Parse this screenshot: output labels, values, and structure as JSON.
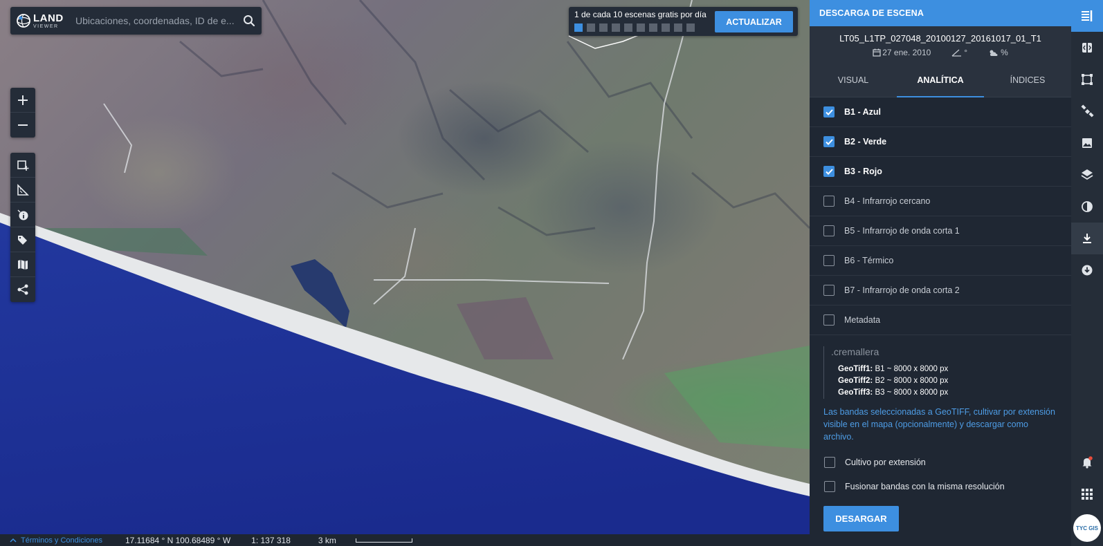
{
  "search": {
    "logo_main": "LAND",
    "logo_sub": "VIEWER",
    "placeholder": "Ubicaciones, coordenadas, ID de e..."
  },
  "map_tools": {
    "zoom": [
      "zoom-in",
      "zoom-out"
    ],
    "tools": [
      "add-aoi-icon",
      "measure-icon",
      "info-icon",
      "tag-icon",
      "map-icon",
      "share-icon"
    ]
  },
  "banner": {
    "text": "1 de cada 10 escenas gratis por día",
    "total_scenes": 10,
    "used_scenes": 1,
    "button": "ACTUALIZAR"
  },
  "statusbar": {
    "terms": "Términos y Condiciones",
    "coordinates": "17.11684 ° N 100.68489 ° W",
    "scale": "1: 137 318",
    "distance": "3 km"
  },
  "panel": {
    "title": "DESCARGA DE ESCENA",
    "scene_id": "LT05_L1TP_027048_20100127_20161017_01_T1",
    "date": "27 ene. 2010",
    "angle": "°",
    "cloud": "%",
    "tabs": [
      {
        "label": "VISUAL",
        "active": false
      },
      {
        "label": "ANALÍTICA",
        "active": true
      },
      {
        "label": "ÍNDICES",
        "active": false
      }
    ],
    "bands": [
      {
        "label": "B1 - Azul",
        "checked": true
      },
      {
        "label": "B2 - Verde",
        "checked": true
      },
      {
        "label": "B3 - Rojo",
        "checked": true
      },
      {
        "label": "B4 - Infrarrojo cercano",
        "checked": false
      },
      {
        "label": "B5 - Infrarrojo de onda corta 1",
        "checked": false
      },
      {
        "label": "B6 - Térmico",
        "checked": false
      },
      {
        "label": "B7 - Infrarrojo de onda corta 2",
        "checked": false
      },
      {
        "label": "Metadata",
        "checked": false
      }
    ],
    "zip_title": ".cremallera",
    "geotiffs": [
      {
        "name": "GeoTiff1:",
        "detail": "B1 ~ 8000 x 8000 px"
      },
      {
        "name": "GeoTiff2:",
        "detail": "B2 ~ 8000 x 8000 px"
      },
      {
        "name": "GeoTiff3:",
        "detail": "B3 ~ 8000 x 8000 px"
      }
    ],
    "description": "Las bandas seleccionadas a GeoTIFF, cultivar por extensión visible en el mapa (opcionalmente) y descargar como archivo.",
    "option_crop": "Cultivo por extensión",
    "option_merge": "Fusionar bandas con la misma resolución",
    "download_button": "DESARGAR"
  },
  "rail": {
    "avatar_text": "TYC GIS"
  },
  "colors": {
    "accent": "#3d8fe0",
    "panel_bg": "#1f2733",
    "ocean": "#1c2f96"
  }
}
